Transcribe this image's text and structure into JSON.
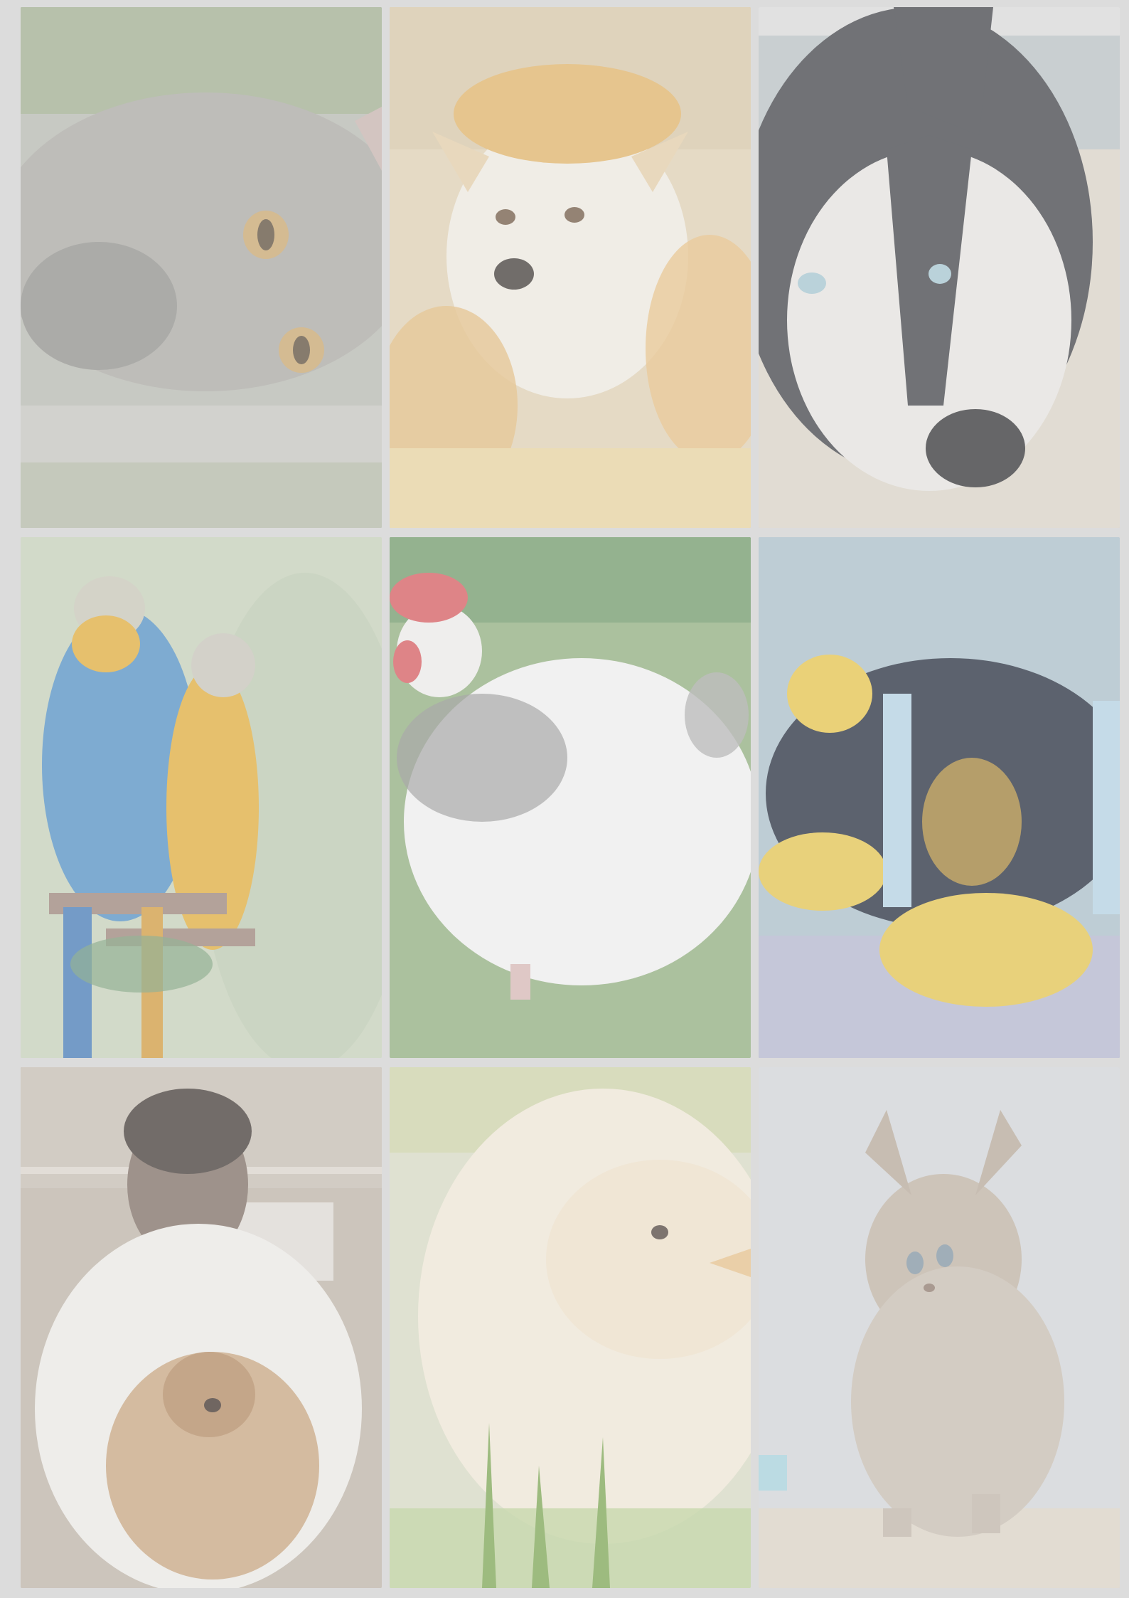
{
  "grid": {
    "tiles": [
      {
        "subject": "tabby-cat-lying"
      },
      {
        "subject": "shiba-dog-in-autumn-leaves"
      },
      {
        "subject": "husky-on-beach"
      },
      {
        "subject": "two-macaw-parrots"
      },
      {
        "subject": "white-hen-on-grass"
      },
      {
        "subject": "clownfish"
      },
      {
        "subject": "man-holding-pomeranian"
      },
      {
        "subject": "yellow-chick"
      },
      {
        "subject": "fluffy-kitten"
      }
    ]
  },
  "colors": {
    "page_background": "#dcdcdc"
  }
}
